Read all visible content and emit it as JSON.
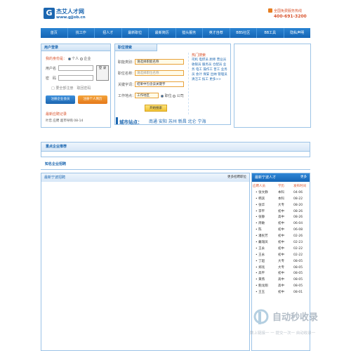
{
  "header": {
    "logo_mark": "G",
    "site_name": "杰艾人才网",
    "site_url": "www.gjjob.cn",
    "hotline_label": "全国免费服务热线",
    "hotline_number": "400-691-3200"
  },
  "nav": [
    "首页",
    "找工作",
    "招人才",
    "最新职位",
    "最新简历",
    "猎头服务",
    "英才自荐",
    "BBS社区",
    "BB工具",
    "隐私声明"
  ],
  "login": {
    "title": "用户登录",
    "user_type_label": "我的身份是：",
    "option_personal": "个人",
    "option_company": "企业",
    "username_label": "用户名",
    "password_label": "密　码",
    "login_button": "登 录",
    "remember": "□ 要全部注册　取回密码",
    "register_company": "注册企业会员",
    "register_personal": "注册个人简历",
    "recent_title": "最新应聘记录",
    "recent_item": "叶忠 应聘 超市导购 08-14"
  },
  "search": {
    "title": "职位搜索",
    "category_label": "职能类别：",
    "category_value": "请选择职能名称",
    "position_label": "职位名称：",
    "position_placeholder": "请选择职位名称",
    "keyword_label": "关键字词：",
    "keyword_value": "结果中包含该关键字",
    "location_label": "工作地点：",
    "location_value": "工作地区",
    "radio_position": "职位",
    "radio_company": "公司",
    "search_button": "开始搜索",
    "hot_title": "热门搜索",
    "hot_words": "司机 电焊员 厨师 营业员 收银员 服务员 仓配员 业务 电工 操作工 普工 业务员 会计 保安 出纳 管理员 清洁工 技工 更多>>"
  },
  "city": {
    "label": "城市站点：",
    "sites": "南通 安阳 苏州 新昌 北仑 宁海"
  },
  "sections": {
    "recommend": "重点企业推荐",
    "famous": "知名企业招聘",
    "latest_jobs": "最新宁波招聘",
    "more_jobs": "更多招聘职位",
    "latest_talent": "最新宁波人才",
    "more_talent": "更多"
  },
  "talent": {
    "headers": [
      "应聘人员",
      "学历",
      "发布时间"
    ],
    "rows": [
      [
        "张文静",
        "本科",
        "04-06"
      ],
      [
        "韩滨",
        "本科",
        "08-22"
      ],
      [
        "张华",
        "大专",
        "08-20"
      ],
      [
        "李平",
        "初中",
        "08-26"
      ],
      [
        "张静",
        "高中",
        "08-26"
      ],
      [
        "周敏",
        "初中",
        "06-04"
      ],
      [
        "陈",
        "初中",
        "06-08"
      ],
      [
        "潘民芳",
        "初中",
        "02-26"
      ],
      [
        "戴瑞凤",
        "初中",
        "02-23"
      ],
      [
        "王永",
        "初中",
        "02-22"
      ],
      [
        "王永",
        "初中",
        "02-22"
      ],
      [
        "丁超",
        "大专",
        "08-05"
      ],
      [
        "郑兆",
        "大专",
        "08-05"
      ],
      [
        "高平",
        "初中",
        "08-05"
      ],
      [
        "黄燕",
        "高中",
        "08-05"
      ],
      [
        "鲍龙翔",
        "高中",
        "08-05"
      ],
      [
        "王玉",
        "初中",
        "08-01"
      ]
    ]
  },
  "watermark": {
    "brand": "自动秒收录",
    "tagline": "数上链接一 一 提交一次一 自动收录一"
  },
  "colors": {
    "primary": "#1b66b0",
    "nav_gradient": "#2a83d2",
    "accent_orange": "#e5781a",
    "alert_red": "#d9532c"
  }
}
